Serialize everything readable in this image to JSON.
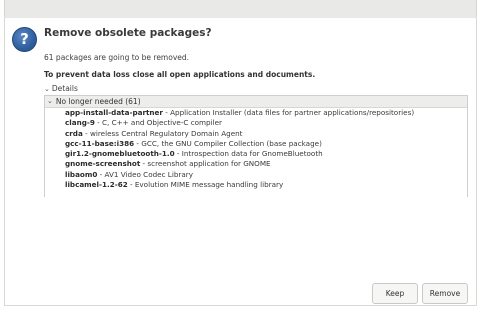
{
  "dialog": {
    "title": "Remove obsolete packages?",
    "count_text": "61 packages are going to be removed.",
    "warning_text": "To prevent data loss close all open applications and documents.",
    "details_label": "Details",
    "question_icon": "?"
  },
  "tree": {
    "group_label": "No longer needed (61)",
    "packages": [
      {
        "name": "app-install-data-partner",
        "desc": " - Application Installer (data files for partner applications/repositories)"
      },
      {
        "name": "clang-9",
        "desc": " - C, C++ and Objective-C compiler"
      },
      {
        "name": "crda",
        "desc": " - wireless Central Regulatory Domain Agent"
      },
      {
        "name": "gcc-11-base:i386",
        "desc": " - GCC, the GNU Compiler Collection (base package)"
      },
      {
        "name": "gir1.2-gnomebluetooth-1.0",
        "desc": " - Introspection data for GnomeBluetooth"
      },
      {
        "name": "gnome-screenshot",
        "desc": " - screenshot application for GNOME"
      },
      {
        "name": "libaom0",
        "desc": " - AV1 Video Codec Library"
      },
      {
        "name": "libcamel-1.2-62",
        "desc": " - Evolution MIME message handling library"
      }
    ]
  },
  "buttons": {
    "keep_label": "Keep",
    "remove_label": "Remove"
  }
}
